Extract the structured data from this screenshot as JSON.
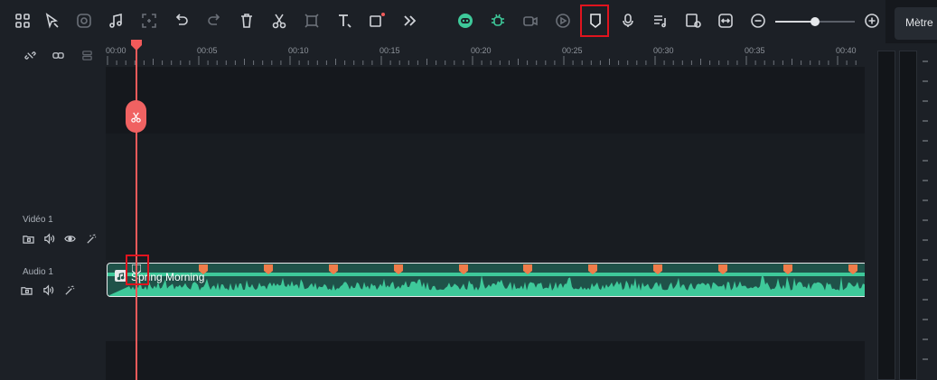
{
  "toolbar": {
    "left_tools": [
      "grid-icon",
      "select-icon",
      "ai-mask-icon",
      "audio-note-icon",
      "crop-icon",
      "undo-icon",
      "redo-icon",
      "delete-icon",
      "cut-icon",
      "transform-icon",
      "text-icon",
      "record-icon",
      "more-icon"
    ],
    "right_tools": [
      "ai-face-icon",
      "ai-bug-icon",
      "ai-video-icon",
      "play-circle-icon",
      "marker-icon",
      "microphone-icon",
      "audio-list-icon",
      "screen-icon",
      "fit-icon"
    ],
    "zoom_level": 0.5,
    "meter_tab": "Mètre"
  },
  "ruler": {
    "ticks": [
      "00:00",
      "00:05",
      "00:10",
      "00:15",
      "00:20",
      "00:25",
      "00:30",
      "00:35",
      "00:40"
    ]
  },
  "tracks": {
    "video": {
      "label": "Vidéo 1"
    },
    "audio": {
      "label": "Audio 1"
    }
  },
  "clip": {
    "title": "Spring Morning",
    "marker_count": 12
  },
  "colors": {
    "accent_green": "#3ec99a",
    "playhead": "#f15a5a",
    "marker": "#f07c4a",
    "highlight": "#e0141e"
  }
}
